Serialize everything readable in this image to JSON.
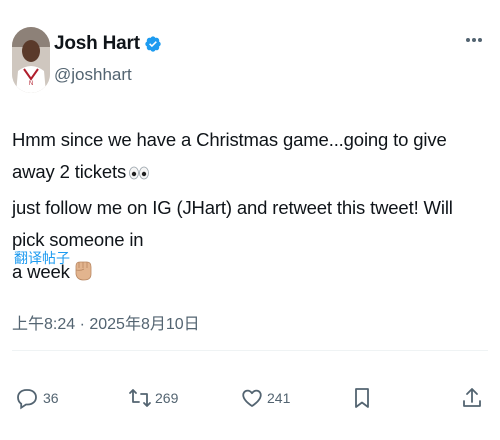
{
  "author": {
    "display_name": "Josh Hart",
    "handle": "@joshhart",
    "verified_icon": "verified-badge-icon",
    "badge_color": "#1d9bf0"
  },
  "tweet": {
    "text_lines": [
      "Hmm since we have a Christmas game...going to give away 2 tickets",
      "just follow me on IG (JHart) and retweet this tweet! Will pick someone in",
      "a week"
    ],
    "emojis": [
      "eyes-emoji",
      "fist-emoji"
    ],
    "translate_label": "翻译帖子",
    "timestamp": "上午8:24 · 2025年8月10日"
  },
  "actions": {
    "reply_count": "36",
    "retweet_count": "269",
    "like_count": "241"
  },
  "colors": {
    "accent": "#1d9bf0",
    "text": "#0f1419",
    "muted": "#536471"
  }
}
